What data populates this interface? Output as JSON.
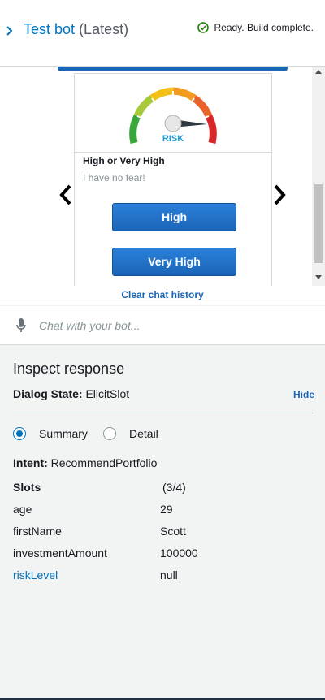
{
  "header": {
    "title": "Test bot",
    "version": "(Latest)",
    "status": "Ready. Build complete."
  },
  "chat": {
    "card": {
      "gauge_label": "RISK",
      "title": "High or Very High",
      "subtitle": "I have no fear!",
      "buttons": [
        "High",
        "Very High"
      ]
    },
    "clear_label": "Clear chat history"
  },
  "input": {
    "placeholder": "Chat with your bot..."
  },
  "inspect": {
    "title": "Inspect response",
    "dialog_label": "Dialog State:",
    "dialog_value": "ElicitSlot",
    "hide_label": "Hide",
    "radios": {
      "summary": "Summary",
      "detail": "Detail",
      "selected": "Summary"
    },
    "intent_label": "Intent:",
    "intent_value": "RecommendPortfolio",
    "slots_label": "Slots",
    "slots_count": "(3/4)",
    "slots": [
      {
        "name": "age",
        "value": "29"
      },
      {
        "name": "firstName",
        "value": "Scott"
      },
      {
        "name": "investmentAmount",
        "value": "100000"
      },
      {
        "name": "riskLevel",
        "value": "null"
      }
    ]
  },
  "colors": {
    "accent": "#0073bb",
    "button": "#1a65b8",
    "success": "#1d8102"
  }
}
